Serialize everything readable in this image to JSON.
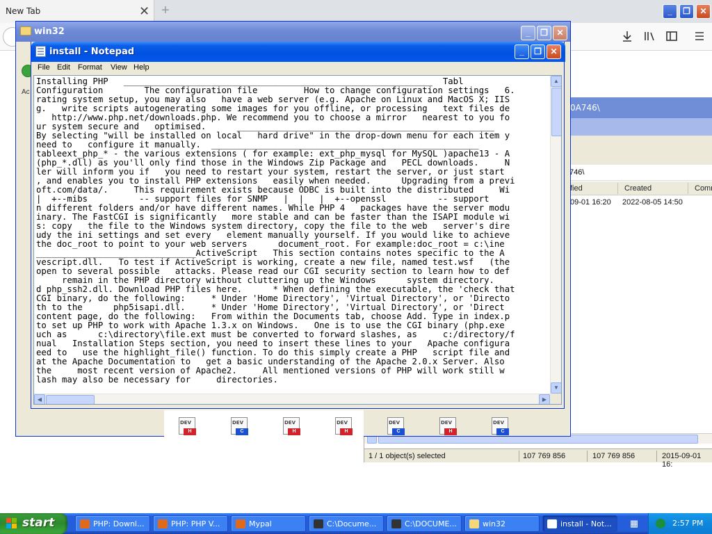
{
  "browser": {
    "tab_title": "New Tab",
    "tab_close": "✕",
    "new_tab": "+",
    "win_min": "_",
    "win_max": "❐",
    "win_close": "✕",
    "toolbar_icons": [
      "download-icon",
      "library-icon",
      "sidebar-icon",
      "menu-icon"
    ]
  },
  "explorer": {
    "title": "win32",
    "path_fragment": "0A746\\",
    "address_fragment": "746\\",
    "columns": [
      "fied",
      "Created",
      "Comm"
    ],
    "row": {
      "modified": "09-01 16:20",
      "created": "2022-08-05 14:50"
    },
    "status": [
      "1 / 1 object(s) selected",
      "107 769 856",
      "107 769 856",
      "2015-09-01 16:"
    ],
    "file_icons": [
      {
        "label": "DEV",
        "badge": "H",
        "badge_color": "#d2232a"
      },
      {
        "label": "DEV",
        "badge": "C",
        "badge_color": "#1b4fd1"
      },
      {
        "label": "DEV",
        "badge": "H",
        "badge_color": "#d2232a"
      },
      {
        "label": "DEV",
        "badge": "H",
        "badge_color": "#d2232a"
      },
      {
        "label": "DEV",
        "badge": "C",
        "badge_color": "#1b4fd1"
      },
      {
        "label": "DEV",
        "badge": "H",
        "badge_color": "#d2232a"
      },
      {
        "label": "DEV",
        "badge": "C",
        "badge_color": "#1b4fd1"
      }
    ]
  },
  "notepad": {
    "title": "install - Notepad",
    "menu": [
      "File",
      "Edit",
      "Format",
      "View",
      "Help"
    ],
    "lines": [
      "Installing PHP   ____________________________________________________________  Tabl",
      "Configuration        The configuration file         How to change configuration settings   6.",
      "rating system setup, you may also   have a web server (e.g. Apache on Linux and MacOS X; IIS",
      "g.   write scripts autogenerating some images for you offline, or processing   text files de",
      "   http://www.php.net/downloads.php. We recommend you to choose a mirror   nearest to you fo",
      "ur system secure and   optimised.      __________________________________________________",
      "By selecting \"will be installed on local   hard drive\" in the drop-down menu for each item y",
      "need to   configure it manually.  ____________________________________________________",
      "tableext_php_* - the various extensions ( for example: ext_php_mysql for MySQL )apache13 - A",
      "(php_*.dll) as you'll only find those in the Windows Zip Package and   PECL downloads.     N",
      "ler will inform you if   you need to restart your system, restart the server, or just start",
      ", and enables you to install PHP extensions   easily when needed.      Upgrading from a previ",
      "oft.com/data/.     This requirement exists because ODBC is built into the distributed     Wi",
      "|  +--mibs          -- support files for SNMP   |  |   |  +--openssl          -- support",
      "n different folders and/or have different names. While PHP 4   packages have the server modu",
      "inary. The FastCGI is significantly   more stable and can be faster than the ISAPI module wi",
      "s: copy   the file to the Windows system directory, copy the file to the web   server's dire",
      "udy the ini settings and set every   element manually yourself. If you would like to achieve",
      "the doc_root to point to your web servers      document_root. For example:doc_root = c:\\ine",
      "_______________________________ActiveScript   This section contains notes specific to the A",
      "vescript.dll.   To test if ActiveScript is working, create a new file, named test.wsf   (the",
      "open to several possible   attacks. Please read our CGI security section to learn how to def",
      "     remain in the PHP directory without cluttering up the Windows      system directory.",
      "d php_ssh2.dll. Download PHP files here.      * When defining the executable, the 'check that",
      "CGI binary, do the following:     * Under 'Home Directory', 'Virtual Directory', or 'Directo",
      "th to the      php5isapi.dll.     * Under 'Home Directory', 'Virtual Directory', or 'Direct",
      "content page, do the following:   From within the Documents tab, choose Add. Type in index.p",
      "to set up PHP to work with Apache 1.3.x on Windows.   One is to use the CGI binary (php.exe",
      "uch as      c:\\directory\\file.ext must be converted to forward slashes, as     c:/directory/f",
      "nual   Installation Steps section, you need to insert these lines to your   Apache configura",
      "eed to   use the highlight_file() function. To do this simply create a PHP   script file and",
      "at the Apache Documentation to   get a basic understanding of the Apache 2.0.x Server. Also",
      "the     most recent version of Apache2.     All mentioned versions of PHP will work still w",
      "lash may also be necessary for     directories."
    ]
  },
  "taskbar": {
    "start": "start",
    "clock": "2:57 PM",
    "items": [
      {
        "label": "PHP: Downl...",
        "color": "#e2681a"
      },
      {
        "label": "PHP: PHP V...",
        "color": "#e2681a"
      },
      {
        "label": "Mypal",
        "color": "#e2681a"
      },
      {
        "label": "C:\\Docume...",
        "color": "#333333"
      },
      {
        "label": "C:\\DOCUME...",
        "color": "#333333"
      },
      {
        "label": "win32",
        "color": "#f5d77a"
      },
      {
        "label": "install - Not...",
        "color": "#ffffff"
      }
    ]
  }
}
